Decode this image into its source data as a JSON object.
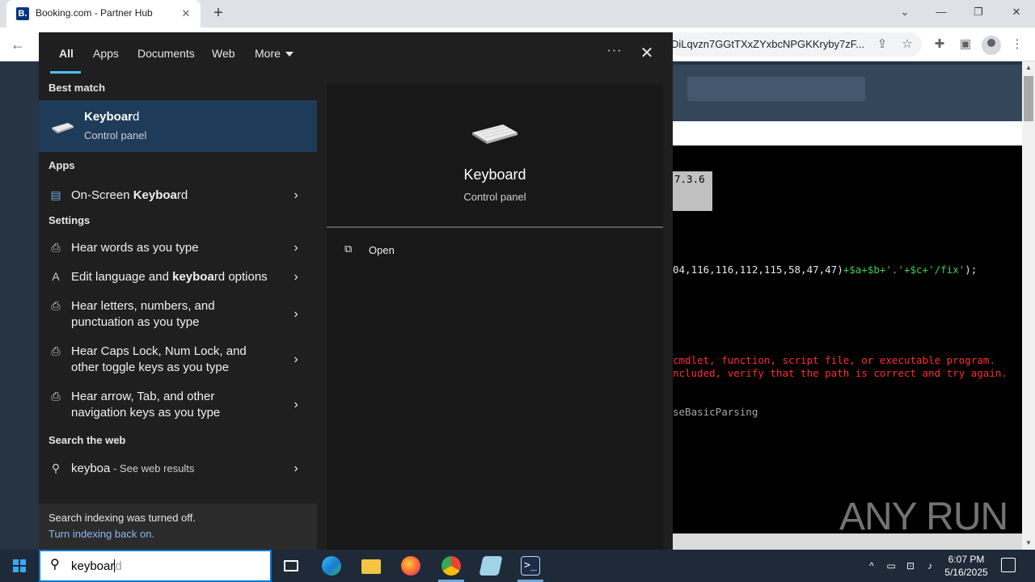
{
  "browser": {
    "tab_title": "Booking.com - Partner Hub",
    "favicon_letter": "B.",
    "url_fragment": "DiLqvzn7GGtTXxZYxbcNPGKKryby7zF..."
  },
  "console": {
    "box_text": "7.3.6",
    "line1_plain": "04,116,116,112,115,58,47,47)",
    "line1_green": "+$a+$b+'.'+$c+'/fix'",
    "line1_end": ");",
    "error1": " cmdlet, function, script file, or executable program.",
    "error2": "ncluded, verify that the path is correct and try again.",
    "line3": "seBasicParsing"
  },
  "watermark": "ANY  RUN",
  "search_panel": {
    "tabs": [
      "All",
      "Apps",
      "Documents",
      "Web",
      "More"
    ],
    "more_dots": "···",
    "best_match_header": "Best match",
    "best_match": {
      "title_bold": "Keyboar",
      "title_rest": "d",
      "subtitle": "Control panel"
    },
    "apps_header": "Apps",
    "apps": [
      {
        "pre": "On-Screen ",
        "bold": "Keyboa",
        "post": "rd"
      }
    ],
    "settings_header": "Settings",
    "settings": [
      {
        "pre": "Hear words as you type",
        "bold": "",
        "post": ""
      },
      {
        "pre": "Edit language and ",
        "bold": "keyboa",
        "post": "rd options"
      },
      {
        "pre": "Hear letters, numbers, and punctuation as you type",
        "bold": "",
        "post": ""
      },
      {
        "pre": "Hear Caps Lock, Num Lock, and other toggle keys as you type",
        "bold": "",
        "post": ""
      },
      {
        "pre": "Hear arrow, Tab, and other navigation keys as you type",
        "bold": "",
        "post": ""
      }
    ],
    "web_header": "Search the web",
    "web": {
      "query": "keyboa",
      "suffix": " - See web results"
    },
    "indexing": {
      "message": "Search indexing was turned off.",
      "link": "Turn indexing back on."
    }
  },
  "detail": {
    "title": "Keyboard",
    "subtitle": "Control panel",
    "action_open": "Open"
  },
  "taskbar": {
    "search_typed": "keyboar",
    "search_ghost": "d",
    "time": "6:07 PM",
    "date": "5/16/2025"
  },
  "colors": {
    "accent": "#4cc2ff",
    "best_match_bg": "#1f3b5a",
    "console_green": "#3cd04c",
    "console_red": "#ff2e2e"
  }
}
